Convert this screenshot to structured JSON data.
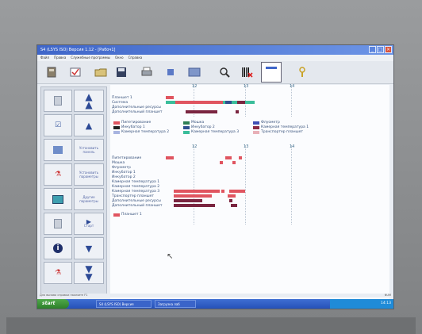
{
  "window": {
    "title": "S4 (LSYS ISO) Версия 1.12 - [Рабоч1]",
    "controls": [
      "_",
      "□",
      "×"
    ]
  },
  "menu": [
    "Файл",
    "Правка",
    "Служебные программы",
    "Окно",
    "Справка"
  ],
  "toolbar": {
    "icons": [
      "device-icon",
      "check-icon",
      "folder-icon",
      "save-icon",
      "print-icon",
      "stop-icon",
      "box-icon",
      "zoom-icon",
      "barcode-icon",
      "window-icon",
      "help-icon"
    ]
  },
  "sidebar": {
    "buttons": [
      {
        "label": "",
        "icon": "doc-icon"
      },
      {
        "label": "",
        "icon": "double-up-icon"
      },
      {
        "label": "",
        "icon": "check-icon"
      },
      {
        "label": "",
        "icon": "up-icon"
      },
      {
        "label": "",
        "icon": "panel-icon"
      },
      {
        "label": "Установить панель",
        "icon": ""
      },
      {
        "label": "",
        "icon": "tubes-icon"
      },
      {
        "label": "Установить параметры",
        "icon": ""
      },
      {
        "label": "",
        "icon": "monitor-icon"
      },
      {
        "label": "Другие параметры",
        "icon": ""
      },
      {
        "label": "",
        "icon": "doc-icon"
      },
      {
        "label": "Старт",
        "icon": "play-icon"
      },
      {
        "label": "",
        "icon": "info-icon"
      },
      {
        "label": "",
        "icon": "down-icon"
      },
      {
        "label": "",
        "icon": "tubes-icon"
      },
      {
        "label": "",
        "icon": "double-down-icon"
      }
    ]
  },
  "chart_data": {
    "type": "gantt",
    "panels": [
      {
        "ticks": [
          "12",
          "13",
          "14"
        ],
        "rows": [
          "Планшет 1",
          "Система",
          "Дополнительные ресурсы",
          "Дополнительный планшет"
        ],
        "legend": [
          {
            "label": "Пипетирование",
            "color": "#e05560"
          },
          {
            "label": "Инкубатор 1",
            "color": "#222222"
          },
          {
            "label": "Камерная температура 2",
            "color": "#a8b4e0"
          },
          {
            "label": "Мошка",
            "color": "#2f7f55"
          },
          {
            "label": "Инкубатор 2",
            "color": "#2f4f8f"
          },
          {
            "label": "Камерная температура 3",
            "color": "#3bbd9b"
          },
          {
            "label": "Флуометр",
            "color": "#3f4fb5"
          },
          {
            "label": "Камерная температура 1",
            "color": "#8a2a45"
          },
          {
            "label": "Транспортер планшет",
            "color": "#e8b0b8"
          }
        ]
      },
      {
        "ticks": [
          "12",
          "13",
          "14"
        ],
        "rows": [
          "Пипетирование",
          "Мошка",
          "Флуометр",
          "Инкубатор 1",
          "Инкубатор 2",
          "Камерная температура 1",
          "Камерная температура 2",
          "Камерная температура 3",
          "Транспортер планшет",
          "Дополнительные ресурсы",
          "Дополнительный планшет"
        ],
        "legend": [
          {
            "label": "Планшет 1",
            "color": "#e05560"
          }
        ]
      }
    ]
  },
  "statusbar": {
    "text": "Для вызова справки нажмите F1",
    "right": "NUM"
  },
  "taskbar": {
    "start": "start",
    "tasks": [
      "S4 (LSYS ISO) Версия",
      "Загрузка лаб"
    ],
    "clock": "14:13"
  },
  "colors": {
    "accent": "#3f66c9",
    "bar_red": "#e05560",
    "bar_dark": "#7a2540",
    "bar_teal": "#3bbd9b"
  }
}
